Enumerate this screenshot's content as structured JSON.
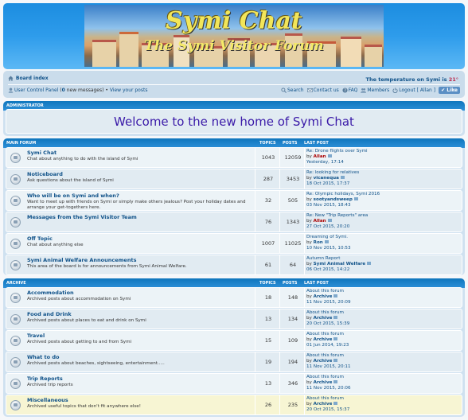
{
  "banner": {
    "title": "Symi Chat",
    "subtitle": "The Symi Visitor Forum"
  },
  "nav": {
    "board_index": "Board index",
    "temperature_label": "The temperature on Symi is",
    "temperature_value": "21°",
    "ucp": "User Control Panel",
    "new_messages_prefix": " (",
    "new_messages_count": "0",
    "new_messages_suffix": " new messages)",
    "bullet": " • ",
    "view_posts": "View your posts",
    "search": "Search",
    "contact": "Contact us",
    "faq": "FAQ",
    "members": "Members",
    "logout": "Logout [ Allan ]",
    "like": "Like"
  },
  "admin": {
    "title": "Administrator",
    "welcome": "Welcome to the new home of Symi Chat"
  },
  "main_forum": {
    "title": "Main Forum",
    "col_topics": "Topics",
    "col_posts": "Posts",
    "col_last": "Last Post",
    "rows": [
      {
        "title": "Symi Chat",
        "desc": "Chat about anything to do with the island of Symi",
        "topics": "1043",
        "posts": "12059",
        "last_title": "Re: Drone flights over Symi",
        "by": "by",
        "author": "Allan",
        "author_red": true,
        "date": "Yesterday, 17:14"
      },
      {
        "title": "Noticeboard",
        "desc": "Ask questions about the island of Symi",
        "topics": "287",
        "posts": "3453",
        "last_title": "Re: looking for relatives",
        "by": "by",
        "author": "vicanequa",
        "author_red": false,
        "date": "18 Oct 2015, 17:37"
      },
      {
        "title": "Who will be on Symi and when?",
        "desc": "Want to meet up with friends on Symi or simply make others jealous? Post your holiday dates and arrange your get-togethers here.",
        "topics": "32",
        "posts": "505",
        "last_title": "Re: Olympic holidays, Symi 2016",
        "by": "by",
        "author": "sootyandsweep",
        "author_red": false,
        "date": "03 Nov 2015, 18:43"
      },
      {
        "title": "Messages from the Symi Visitor Team",
        "desc": "",
        "topics": "76",
        "posts": "1343",
        "last_title": "Re: New \"Trip Reports\" area",
        "by": "by",
        "author": "Allan",
        "author_red": true,
        "date": "27 Oct 2015, 20:20"
      },
      {
        "title": "Off Topic",
        "desc": "Chat about anything else",
        "topics": "1007",
        "posts": "11025",
        "last_title": "Dreaming of Symi.",
        "by": "by",
        "author": "Ron",
        "author_red": false,
        "date": "10 Nov 2015, 10:53"
      },
      {
        "title": "Symi Animal Welfare Announcements",
        "desc": "This area of the board is for announcements from Symi Animal Welfare.",
        "topics": "61",
        "posts": "64",
        "last_title": "Autumn Report",
        "by": "by",
        "author": "Symi Animal Welfare",
        "author_red": false,
        "date": "06 Oct 2015, 14:22"
      }
    ]
  },
  "archive": {
    "title": "Archive",
    "col_topics": "Topics",
    "col_posts": "Posts",
    "col_last": "Last Post",
    "rows": [
      {
        "title": "Accommodation",
        "desc": "Archived posts about accommodation on Symi",
        "topics": "18",
        "posts": "148",
        "last_title": "About this forum",
        "by": "by",
        "author": "Archive",
        "author_red": false,
        "date": "11 Nov 2015, 20:09"
      },
      {
        "title": "Food and Drink",
        "desc": "Archived posts about places to eat and drink on Symi",
        "topics": "13",
        "posts": "134",
        "last_title": "About this forum",
        "by": "by",
        "author": "Archive",
        "author_red": false,
        "date": "20 Oct 2015, 15:39"
      },
      {
        "title": "Travel",
        "desc": "Archived posts about getting to and from Symi",
        "topics": "15",
        "posts": "109",
        "last_title": "About this forum",
        "by": "by",
        "author": "Archive",
        "author_red": false,
        "date": "01 Jun 2014, 19:23"
      },
      {
        "title": "What to do",
        "desc": "Archived posts about beaches, sightseeing, entertainment.....",
        "topics": "19",
        "posts": "194",
        "last_title": "About this forum",
        "by": "by",
        "author": "Archive",
        "author_red": false,
        "date": "11 Nov 2015, 20:11"
      },
      {
        "title": "Trip Reports",
        "desc": "Archived trip reports",
        "topics": "13",
        "posts": "346",
        "last_title": "About this forum",
        "by": "by",
        "author": "Archive",
        "author_red": false,
        "date": "11 Nov 2015, 20:06"
      },
      {
        "title": "Miscellaneous",
        "desc": "Archived useful topics that don't fit anywhere else!",
        "topics": "26",
        "posts": "235",
        "last_title": "About this forum",
        "by": "by",
        "author": "Archive",
        "author_red": false,
        "date": "20 Oct 2015, 15:37"
      }
    ]
  }
}
